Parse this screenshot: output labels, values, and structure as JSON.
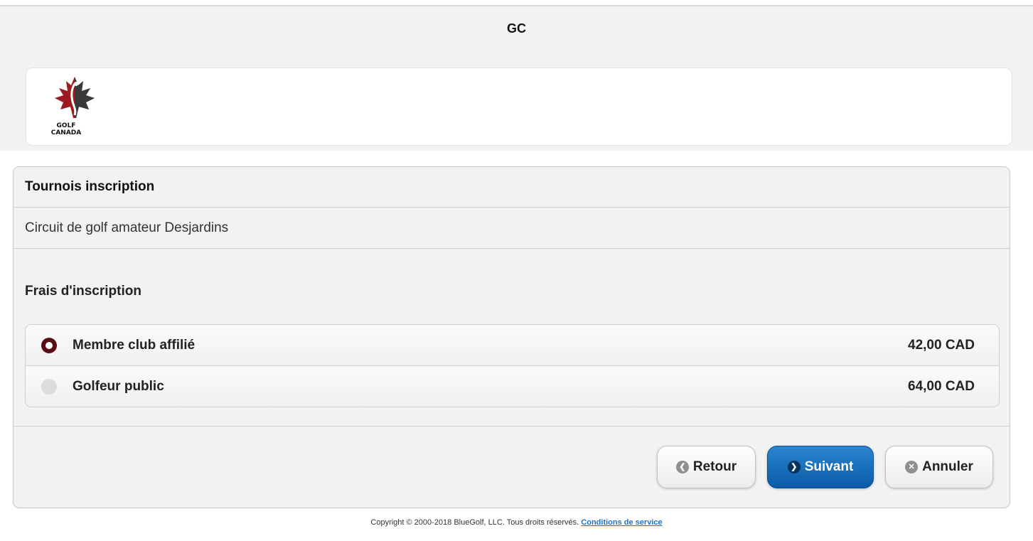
{
  "header": {
    "title": "GC"
  },
  "logo": {
    "line1": "GOLF",
    "line2": "CANADA"
  },
  "panel": {
    "title": "Tournois inscription",
    "subtitle": "Circuit de golf amateur Desjardins",
    "section_label": "Frais d'inscription",
    "options": [
      {
        "label": "Membre club affilié",
        "price": "42,00 CAD",
        "selected": true
      },
      {
        "label": "Golfeur public",
        "price": "64,00 CAD",
        "selected": false
      }
    ],
    "buttons": {
      "back": "Retour",
      "next": "Suivant",
      "cancel": "Annuler"
    }
  },
  "footer": {
    "copyright": "Copyright © 2000-2018 BlueGolf, LLC. Tous droits réservés.",
    "terms_link": "Conditions de service"
  },
  "colors": {
    "accent": "#0a5ba6",
    "radio_selected": "#5a0c12",
    "link": "#1a73c7"
  }
}
